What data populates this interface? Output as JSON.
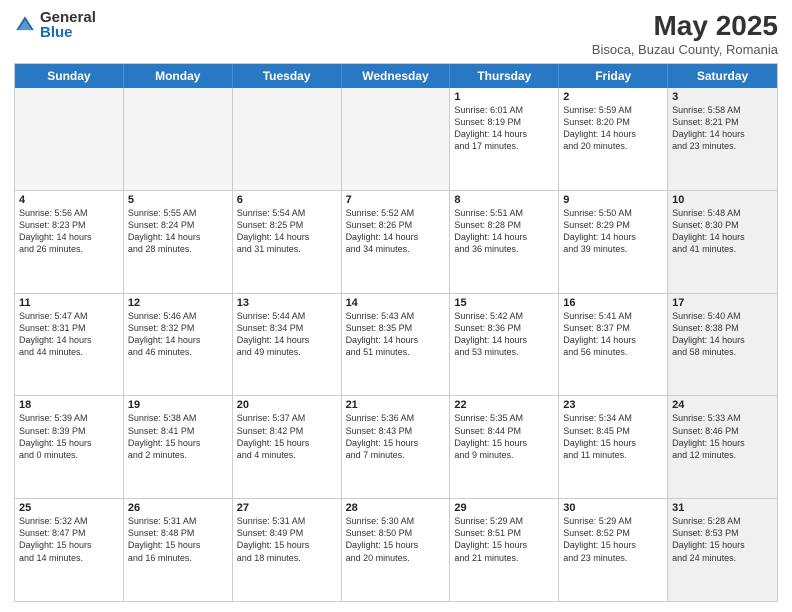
{
  "logo": {
    "general": "General",
    "blue": "Blue"
  },
  "title": {
    "month": "May 2025",
    "location": "Bisoca, Buzau County, Romania"
  },
  "dayHeaders": [
    "Sunday",
    "Monday",
    "Tuesday",
    "Wednesday",
    "Thursday",
    "Friday",
    "Saturday"
  ],
  "weeks": [
    [
      {
        "num": "",
        "info": "",
        "empty": true
      },
      {
        "num": "",
        "info": "",
        "empty": true
      },
      {
        "num": "",
        "info": "",
        "empty": true
      },
      {
        "num": "",
        "info": "",
        "empty": true
      },
      {
        "num": "1",
        "info": "Sunrise: 6:01 AM\nSunset: 8:19 PM\nDaylight: 14 hours\nand 17 minutes."
      },
      {
        "num": "2",
        "info": "Sunrise: 5:59 AM\nSunset: 8:20 PM\nDaylight: 14 hours\nand 20 minutes."
      },
      {
        "num": "3",
        "info": "Sunrise: 5:58 AM\nSunset: 8:21 PM\nDaylight: 14 hours\nand 23 minutes.",
        "shaded": true
      }
    ],
    [
      {
        "num": "4",
        "info": "Sunrise: 5:56 AM\nSunset: 8:23 PM\nDaylight: 14 hours\nand 26 minutes."
      },
      {
        "num": "5",
        "info": "Sunrise: 5:55 AM\nSunset: 8:24 PM\nDaylight: 14 hours\nand 28 minutes."
      },
      {
        "num": "6",
        "info": "Sunrise: 5:54 AM\nSunset: 8:25 PM\nDaylight: 14 hours\nand 31 minutes."
      },
      {
        "num": "7",
        "info": "Sunrise: 5:52 AM\nSunset: 8:26 PM\nDaylight: 14 hours\nand 34 minutes."
      },
      {
        "num": "8",
        "info": "Sunrise: 5:51 AM\nSunset: 8:28 PM\nDaylight: 14 hours\nand 36 minutes."
      },
      {
        "num": "9",
        "info": "Sunrise: 5:50 AM\nSunset: 8:29 PM\nDaylight: 14 hours\nand 39 minutes."
      },
      {
        "num": "10",
        "info": "Sunrise: 5:48 AM\nSunset: 8:30 PM\nDaylight: 14 hours\nand 41 minutes.",
        "shaded": true
      }
    ],
    [
      {
        "num": "11",
        "info": "Sunrise: 5:47 AM\nSunset: 8:31 PM\nDaylight: 14 hours\nand 44 minutes."
      },
      {
        "num": "12",
        "info": "Sunrise: 5:46 AM\nSunset: 8:32 PM\nDaylight: 14 hours\nand 46 minutes."
      },
      {
        "num": "13",
        "info": "Sunrise: 5:44 AM\nSunset: 8:34 PM\nDaylight: 14 hours\nand 49 minutes."
      },
      {
        "num": "14",
        "info": "Sunrise: 5:43 AM\nSunset: 8:35 PM\nDaylight: 14 hours\nand 51 minutes."
      },
      {
        "num": "15",
        "info": "Sunrise: 5:42 AM\nSunset: 8:36 PM\nDaylight: 14 hours\nand 53 minutes."
      },
      {
        "num": "16",
        "info": "Sunrise: 5:41 AM\nSunset: 8:37 PM\nDaylight: 14 hours\nand 56 minutes."
      },
      {
        "num": "17",
        "info": "Sunrise: 5:40 AM\nSunset: 8:38 PM\nDaylight: 14 hours\nand 58 minutes.",
        "shaded": true
      }
    ],
    [
      {
        "num": "18",
        "info": "Sunrise: 5:39 AM\nSunset: 8:39 PM\nDaylight: 15 hours\nand 0 minutes."
      },
      {
        "num": "19",
        "info": "Sunrise: 5:38 AM\nSunset: 8:41 PM\nDaylight: 15 hours\nand 2 minutes."
      },
      {
        "num": "20",
        "info": "Sunrise: 5:37 AM\nSunset: 8:42 PM\nDaylight: 15 hours\nand 4 minutes."
      },
      {
        "num": "21",
        "info": "Sunrise: 5:36 AM\nSunset: 8:43 PM\nDaylight: 15 hours\nand 7 minutes."
      },
      {
        "num": "22",
        "info": "Sunrise: 5:35 AM\nSunset: 8:44 PM\nDaylight: 15 hours\nand 9 minutes."
      },
      {
        "num": "23",
        "info": "Sunrise: 5:34 AM\nSunset: 8:45 PM\nDaylight: 15 hours\nand 11 minutes."
      },
      {
        "num": "24",
        "info": "Sunrise: 5:33 AM\nSunset: 8:46 PM\nDaylight: 15 hours\nand 12 minutes.",
        "shaded": true
      }
    ],
    [
      {
        "num": "25",
        "info": "Sunrise: 5:32 AM\nSunset: 8:47 PM\nDaylight: 15 hours\nand 14 minutes."
      },
      {
        "num": "26",
        "info": "Sunrise: 5:31 AM\nSunset: 8:48 PM\nDaylight: 15 hours\nand 16 minutes."
      },
      {
        "num": "27",
        "info": "Sunrise: 5:31 AM\nSunset: 8:49 PM\nDaylight: 15 hours\nand 18 minutes."
      },
      {
        "num": "28",
        "info": "Sunrise: 5:30 AM\nSunset: 8:50 PM\nDaylight: 15 hours\nand 20 minutes."
      },
      {
        "num": "29",
        "info": "Sunrise: 5:29 AM\nSunset: 8:51 PM\nDaylight: 15 hours\nand 21 minutes."
      },
      {
        "num": "30",
        "info": "Sunrise: 5:29 AM\nSunset: 8:52 PM\nDaylight: 15 hours\nand 23 minutes."
      },
      {
        "num": "31",
        "info": "Sunrise: 5:28 AM\nSunset: 8:53 PM\nDaylight: 15 hours\nand 24 minutes.",
        "shaded": true
      }
    ]
  ]
}
